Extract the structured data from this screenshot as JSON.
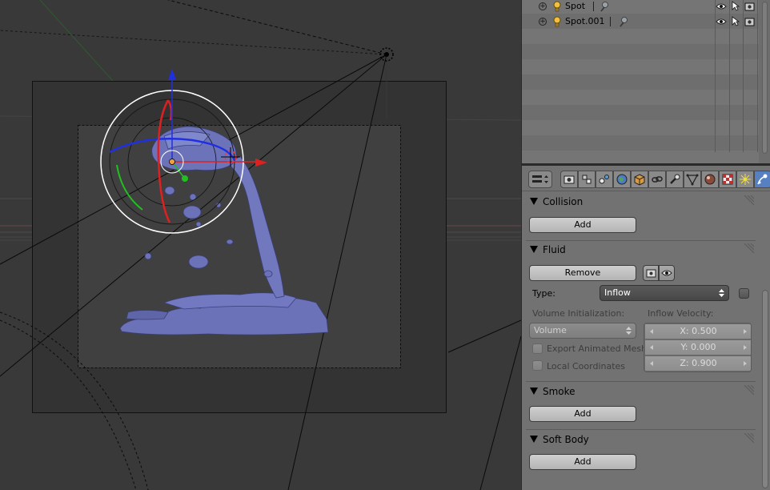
{
  "outliner": {
    "rows": [
      {
        "label": "Spot"
      },
      {
        "label": "Spot.001"
      }
    ]
  },
  "properties": {
    "tabs": [
      "render-tab",
      "render-layers-tab",
      "scene-tab",
      "world-tab",
      "object-tab",
      "constraints-tab",
      "modifiers-tab",
      "data-tab",
      "material-tab",
      "texture-tab",
      "particles-tab",
      "physics-tab"
    ],
    "collision": {
      "title": "Collision",
      "add_label": "Add"
    },
    "fluid": {
      "title": "Fluid",
      "remove_label": "Remove",
      "type_label": "Type:",
      "type_value": "Inflow",
      "volume_init_label": "Volume Initialization:",
      "volume_init_value": "Volume",
      "export_mesh_label": "Export Animated Mesh",
      "local_coords_label": "Local Coordinates",
      "inflow_velocity_label": "Inflow Velocity:",
      "velocity_x": "X: 0.500",
      "velocity_y": "Y: 0.000",
      "velocity_z": "Z: 0.900"
    },
    "smoke": {
      "title": "Smoke",
      "add_label": "Add"
    },
    "soft_body": {
      "title": "Soft Body",
      "add_label": "Add"
    }
  },
  "colors": {
    "active_tab": "#5680c2",
    "fluid_mesh": "#6b72b8",
    "axis_x": "#e02020",
    "axis_y": "#20c020",
    "axis_z": "#2030e0"
  }
}
